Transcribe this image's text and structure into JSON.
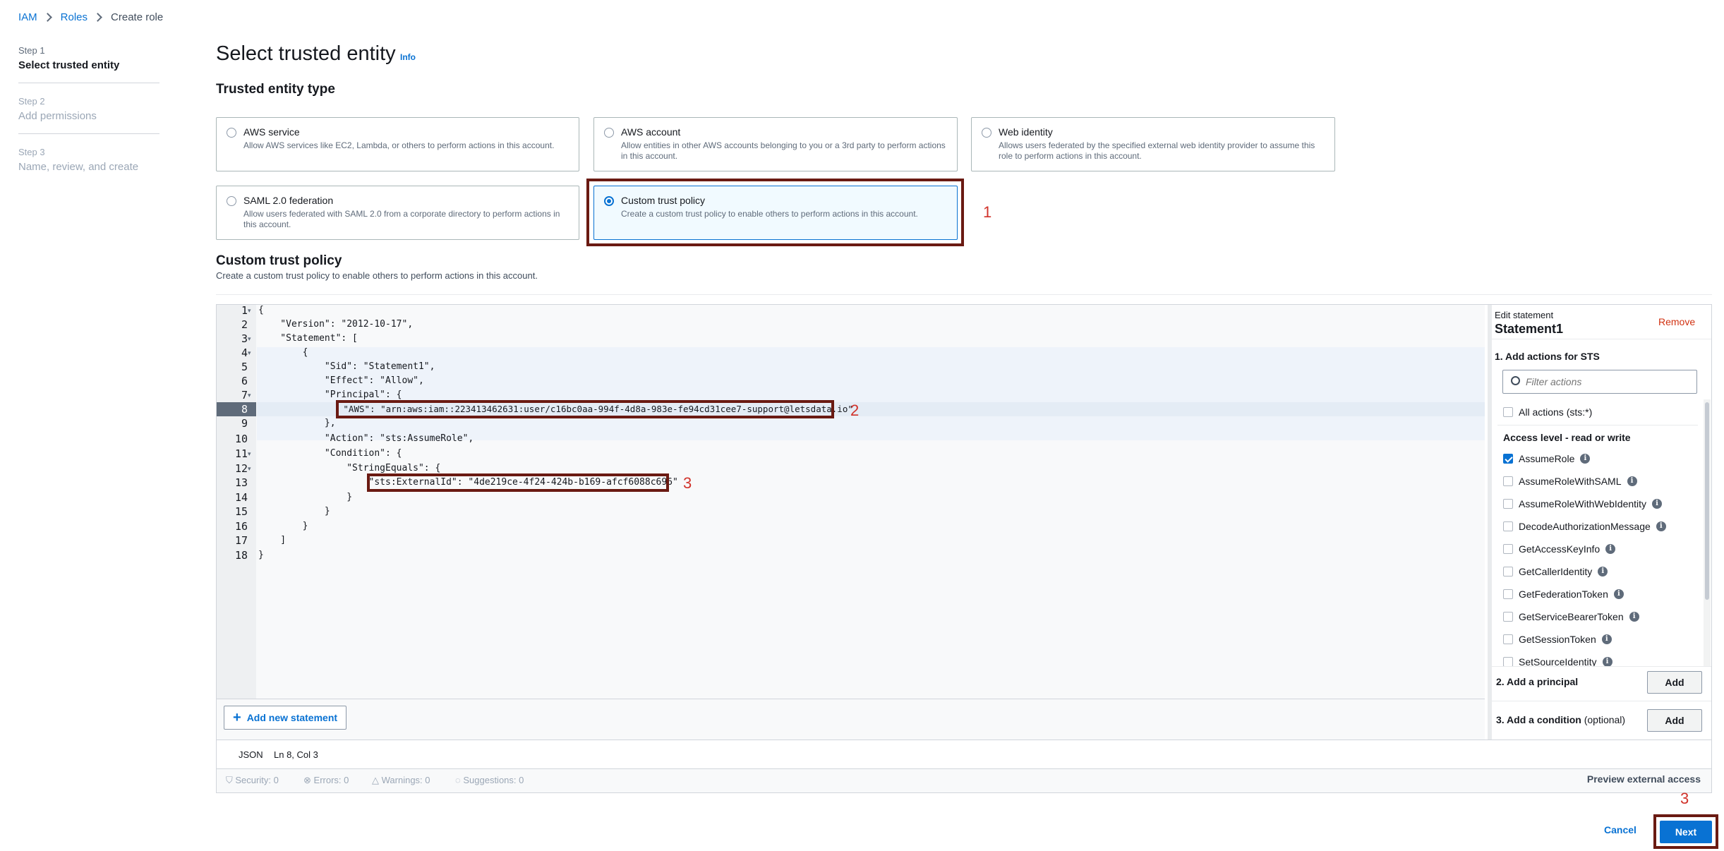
{
  "breadcrumb": {
    "items": [
      "IAM",
      "Roles",
      "Create role"
    ]
  },
  "steps": [
    {
      "num": "Step 1",
      "title": "Select trusted entity"
    },
    {
      "num": "Step 2",
      "title": "Add permissions"
    },
    {
      "num": "Step 3",
      "title": "Name, review, and create"
    }
  ],
  "page": {
    "title": "Select trusted entity",
    "info": "Info"
  },
  "trusted_entity": {
    "heading": "Trusted entity type",
    "tiles": [
      {
        "title": "AWS service",
        "desc": "Allow AWS services like EC2, Lambda, or others to perform actions in this account."
      },
      {
        "title": "AWS account",
        "desc": "Allow entities in other AWS accounts belonging to you or a 3rd party to perform actions in this account."
      },
      {
        "title": "Web identity",
        "desc": "Allows users federated by the specified external web identity provider to assume this role to perform actions in this account."
      },
      {
        "title": "SAML 2.0 federation",
        "desc": "Allow users federated with SAML 2.0 from a corporate directory to perform actions in this account."
      },
      {
        "title": "Custom trust policy",
        "desc": "Create a custom trust policy to enable others to perform actions in this account."
      }
    ],
    "selected": "Custom trust policy"
  },
  "policy": {
    "heading": "Custom trust policy",
    "subtitle": "Create a custom trust policy to enable others to perform actions in this account.",
    "lines": [
      "{",
      "    \"Version\": \"2012-10-17\",",
      "    \"Statement\": [",
      "        {",
      "            \"Sid\": \"Statement1\",",
      "            \"Effect\": \"Allow\",",
      "            \"Principal\": {",
      "                \"AWS\": \"arn:aws:iam::223413462631:user/c16bc0aa-994f-4d8a-983e-fe94cd31cee7-support@letsdata.io\"",
      "            },",
      "            \"Action\": \"sts:AssumeRole\",",
      "            \"Condition\": {",
      "                \"StringEquals\": {",
      "                    \"sts:ExternalId\": \"4de219ce-4f24-424b-b169-afcf6088c696\"",
      "                }",
      "            }",
      "        }",
      "    ]",
      "}"
    ],
    "line_numbers": [
      "1",
      "2",
      "3",
      "4",
      "5",
      "6",
      "7",
      "8",
      "9",
      "10",
      "11",
      "12",
      "13",
      "14",
      "15",
      "16",
      "17",
      "18"
    ],
    "add_statement": "Add new statement",
    "status_mode": "JSON",
    "status_pos": "Ln 8, Col 3",
    "checks": [
      "Security: 0",
      "Errors: 0",
      "Warnings: 0",
      "Suggestions: 0"
    ],
    "preview": "Preview external access"
  },
  "panel": {
    "edit_label": "Edit statement",
    "statement_name": "Statement1",
    "remove": "Remove",
    "actions_heading": "1. Add actions for STS",
    "filter_placeholder": "Filter actions",
    "all_actions": "All actions (sts:*)",
    "access_level": "Access level - read or write",
    "actions": [
      {
        "name": "AssumeRole",
        "checked": true
      },
      {
        "name": "AssumeRoleWithSAML",
        "checked": false
      },
      {
        "name": "AssumeRoleWithWebIdentity",
        "checked": false
      },
      {
        "name": "DecodeAuthorizationMessage",
        "checked": false
      },
      {
        "name": "GetAccessKeyInfo",
        "checked": false
      },
      {
        "name": "GetCallerIdentity",
        "checked": false
      },
      {
        "name": "GetFederationToken",
        "checked": false
      },
      {
        "name": "GetServiceBearerToken",
        "checked": false
      },
      {
        "name": "GetSessionToken",
        "checked": false
      },
      {
        "name": "SetSourceIdentity",
        "checked": false
      }
    ],
    "principal_heading": "2. Add a principal",
    "condition_heading": "3. Add a condition",
    "condition_optional": "(optional)",
    "add_label": "Add"
  },
  "annotations": [
    "1",
    "2",
    "3",
    "3"
  ],
  "footer": {
    "cancel": "Cancel",
    "next": "Next"
  }
}
